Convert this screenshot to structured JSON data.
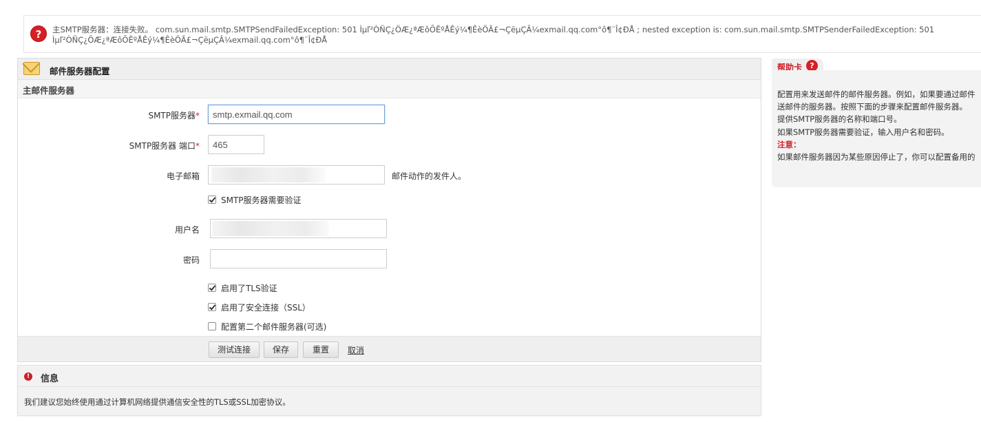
{
  "error": {
    "icon": "question-icon",
    "message": "主SMTP服务器：连接失败。 com.sun.mail.smtp.SMTPSendFailedException: 501 Ìµľ²ÒÑÇ¿ÖÆ¿ªÆôÕÊºÅÊý¼¶ÊèÖÃ£¬ÇëµÇÂ¼exmail.qq.com°ô¶¨Î¢ÐÅ ; nested exception is: com.sun.mail.smtp.SMTPSenderFailedException: 501 Ìµľ²ÒÑÇ¿ÖÆ¿ªÆôÕÊºÅÊý¼¶ÊèÖÃ£¬ÇëµÇÂ¼exmail.qq.com°ô¶¨Î¢ÐÅ"
  },
  "panel": {
    "title": "邮件服务器配置",
    "section": "主邮件服务器",
    "fields": {
      "smtp_server_label": "SMTP服务器",
      "smtp_server_value": "smtp.exmail.qq.com",
      "smtp_port_label": "SMTP服务器 端口",
      "smtp_port_value": "465",
      "email_label": "电子邮箱",
      "email_hint": "邮件动作的发件人。",
      "username_label": "用户名",
      "password_label": "密码",
      "required_mark": "*"
    },
    "checkboxes": {
      "auth": {
        "label": "SMTP服务器需要验证",
        "checked": true
      },
      "tls": {
        "label": "启用了TLS验证",
        "checked": true
      },
      "ssl": {
        "label": "启用了安全连接（SSL）",
        "checked": true
      },
      "secondary": {
        "label": "配置第二个邮件服务器(可选)",
        "checked": false
      }
    },
    "buttons": {
      "test": "测试连接",
      "save": "保存",
      "reset": "重置",
      "cancel": "取消"
    }
  },
  "info": {
    "title": "信息",
    "icon": "info-icon",
    "body": "我们建议您始终使用通过计算机网络提供通信安全性的TLS或SSL加密协议。"
  },
  "help": {
    "tab_label": "帮助卡",
    "lines": [
      "配置用来发送邮件的邮件服务器。例如，如果要通过邮件",
      "送邮件的服务器。按照下面的步骤来配置邮件服务器。",
      "提供SMTP服务器的名称和端口号。",
      "如果SMTP服务器需要验证，输入用户名和密码。"
    ],
    "note_label": "注意：",
    "note_text": "如果邮件服务器因为某些原因停止了，你可以配置备用的"
  }
}
